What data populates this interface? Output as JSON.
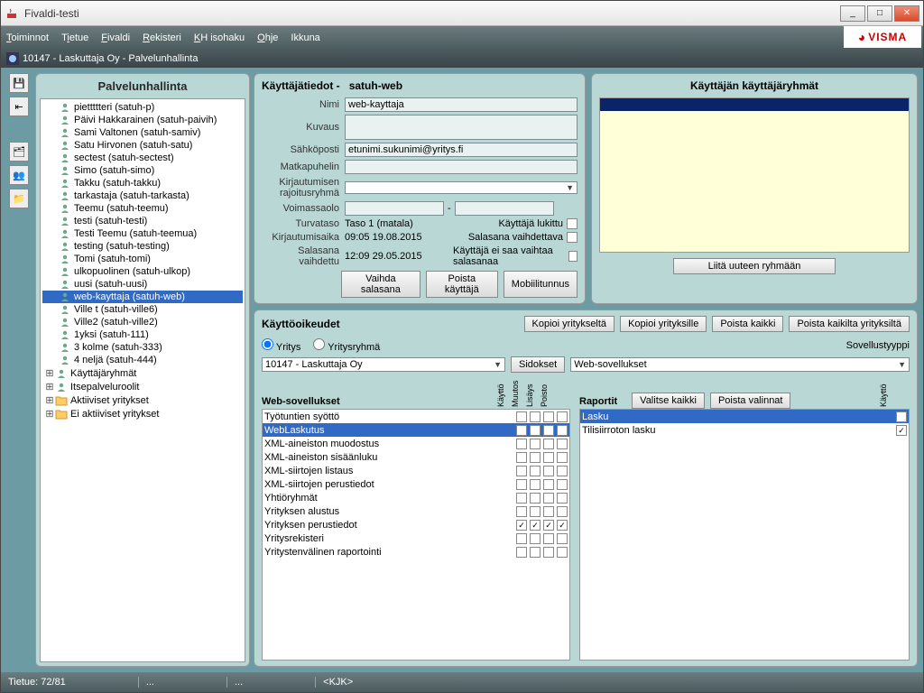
{
  "window": {
    "title": "Fivaldi-testi"
  },
  "menu": [
    "Toiminnot",
    "Tietue",
    "Fivaldi",
    "Rekisteri",
    "KH isohaku",
    "Ohje",
    "Ikkuna"
  ],
  "logo": "VISMA",
  "subtitle": "10147 - Laskuttaja Oy - Palvelunhallinta",
  "left_panel_title": "Palvelunhallinta",
  "tree_users": [
    "piettttteri (satuh-p)",
    "Päivi Hakkarainen (satuh-paivih)",
    "Sami Valtonen (satuh-samiv)",
    "Satu Hirvonen (satuh-satu)",
    "sectest (satuh-sectest)",
    "Simo (satuh-simo)",
    "Takku (satuh-takku)",
    "tarkastaja (satuh-tarkasta)",
    "Teemu (satuh-teemu)",
    "testi (satuh-testi)",
    "Testi Teemu (satuh-teemua)",
    "testing (satuh-testing)",
    "Tomi (satuh-tomi)",
    "ulkopuolinen (satuh-ulkop)",
    "uusi (satuh-uusi)",
    "web-kayttaja (satuh-web)",
    "Ville t (satuh-ville6)",
    "Ville2 (satuh-ville2)",
    "1yksi (satuh-111)",
    "3 kolme (satuh-333)",
    "4 neljä (satuh-444)"
  ],
  "tree_selected_index": 15,
  "tree_categories": [
    "Käyttäjäryhmät",
    "Itsepalveluroolit",
    "Aktiiviset yritykset",
    "Ei aktiiviset yritykset"
  ],
  "user_panel": {
    "title": "Käyttäjätiedot -",
    "username": "satuh-web",
    "labels": {
      "name": "Nimi",
      "desc": "Kuvaus",
      "email": "Sähköposti",
      "mobile": "Matkapuhelin",
      "restrict": "Kirjautumisen rajoitusryhmä",
      "valid": "Voimassaolo",
      "sec": "Turvataso",
      "login": "Kirjautumisaika",
      "pwchg": "Salasana vaihdettu"
    },
    "values": {
      "name": "web-kayttaja",
      "email": "etunimi.sukunimi@yritys.fi",
      "sec": "Taso 1 (matala)",
      "login": "09:05 19.08.2015",
      "pwchg": "12:09 29.05.2015"
    },
    "chk_labels": {
      "locked": "Käyttäjä lukittu",
      "mustchg": "Salasana vaihdettava",
      "nochg": "Käyttäjä ei saa vaihtaa salasanaa"
    },
    "btns": {
      "chgpw": "Vaihda salasana",
      "deluser": "Poista käyttäjä",
      "mobile": "Mobiilitunnus"
    }
  },
  "groups_panel": {
    "title": "Käyttäjän käyttäjäryhmät",
    "btn": "Liitä uuteen ryhmään"
  },
  "perm_panel": {
    "title": "Käyttöoikeudet",
    "btns": {
      "copy_from": "Kopioi yritykseltä",
      "copy_to": "Kopioi yrityksille",
      "del_all": "Poista kaikki",
      "del_all_co": "Poista kaikilta yrityksiltä",
      "sidokset": "Sidokset"
    },
    "radios": {
      "company": "Yritys",
      "group": "Yritysryhmä"
    },
    "combo_company": "10147 - Laskuttaja Oy",
    "apptype_label": "Sovellustyyppi",
    "apptype_value": "Web-sovellukset",
    "web_title": "Web-sovellukset",
    "col_labels": [
      "Käyttö",
      "Muutos",
      "Lisäys",
      "Poisto"
    ],
    "reports_title": "Raportit",
    "rpt_btns": {
      "all": "Valitse kaikki",
      "none": "Poista valinnat"
    },
    "rpt_col": "Käyttö"
  },
  "web_apps": [
    {
      "n": "Työtuntien syöttö",
      "c": [
        0,
        0,
        0,
        0
      ]
    },
    {
      "n": "WebLaskutus",
      "c": [
        1,
        1,
        1,
        1
      ],
      "sel": true
    },
    {
      "n": "XML-aineiston muodostus",
      "c": [
        0,
        0,
        0,
        0
      ]
    },
    {
      "n": "XML-aineiston sisäänluku",
      "c": [
        0,
        0,
        0,
        0
      ]
    },
    {
      "n": "XML-siirtojen listaus",
      "c": [
        0,
        0,
        0,
        0
      ]
    },
    {
      "n": "XML-siirtojen perustiedot",
      "c": [
        0,
        0,
        0,
        0
      ]
    },
    {
      "n": "Yhtiöryhmät",
      "c": [
        0,
        0,
        0,
        0
      ]
    },
    {
      "n": "Yrityksen alustus",
      "c": [
        0,
        0,
        0,
        0
      ]
    },
    {
      "n": "Yrityksen perustiedot",
      "c": [
        1,
        1,
        1,
        1
      ]
    },
    {
      "n": "Yritysrekisteri",
      "c": [
        0,
        0,
        0,
        0
      ]
    },
    {
      "n": "Yritystenvälinen raportointi",
      "c": [
        0,
        0,
        0,
        0
      ]
    }
  ],
  "reports": [
    {
      "n": "Lasku",
      "c": 1,
      "sel": true
    },
    {
      "n": "Tilisiirroton lasku",
      "c": 1
    }
  ],
  "status": {
    "record": "Tietue: 72/81",
    "dots": "...",
    "user": "<KJK>"
  }
}
